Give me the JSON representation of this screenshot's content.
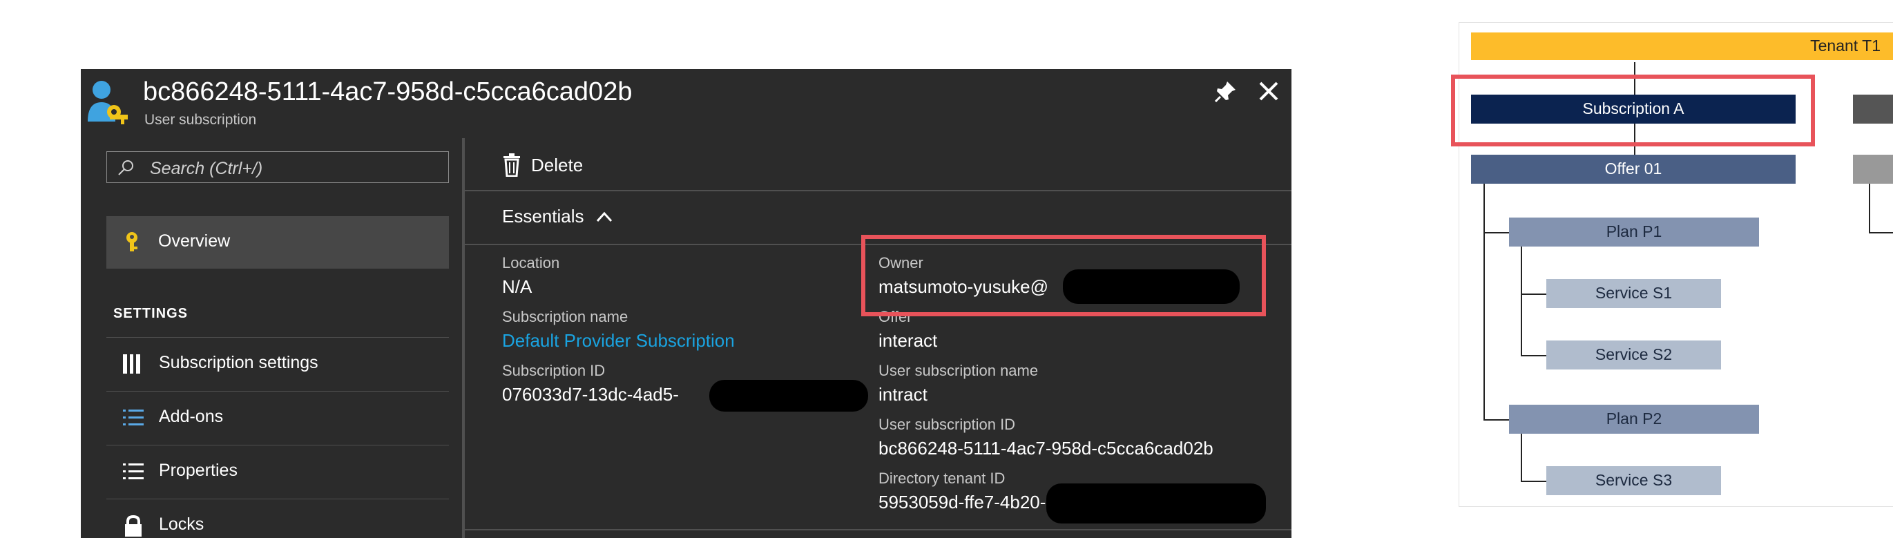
{
  "blade": {
    "title": "bc866248-5111-4ac7-958d-c5cca6cad02b",
    "subtitle": "User subscription",
    "search_placeholder": "Search (Ctrl+/)",
    "nav": {
      "overview": "Overview",
      "settings_header": "SETTINGS",
      "items": [
        "Subscription settings",
        "Add-ons",
        "Properties",
        "Locks"
      ]
    },
    "command_bar": {
      "delete_label": "Delete"
    },
    "essentials_label": "Essentials",
    "fields": {
      "location_label": "Location",
      "location_value": "N/A",
      "subscription_name_label": "Subscription name",
      "subscription_name_value": "Default Provider Subscription",
      "subscription_id_label": "Subscription ID",
      "subscription_id_value": "076033d7-13dc-4ad5-",
      "owner_label": "Owner",
      "owner_value": "matsumoto-yusuke@",
      "offer_label": "Offer",
      "offer_value": "interact",
      "user_sub_name_label": "User subscription name",
      "user_sub_name_value": "intract",
      "user_sub_id_label": "User subscription ID",
      "user_sub_id_value": "bc866248-5111-4ac7-958d-c5cca6cad02b",
      "tenant_id_label": "Directory tenant ID",
      "tenant_id_value": "5953059d-ffe7-4b20-"
    },
    "icons": [
      "subscription-user-key-icon",
      "pin-icon",
      "close-icon",
      "search-icon",
      "key-icon",
      "settings-bars-icon",
      "list-icon",
      "properties-icon",
      "lock-icon",
      "trash-icon",
      "chevron-up-icon"
    ],
    "colors": {
      "background": "#2b2b2b",
      "link": "#1aa3e0",
      "highlight": "#e8535a"
    }
  },
  "diagram": {
    "tenant": "Tenant T1",
    "subscription": "Subscription A",
    "offer": "Offer 01",
    "plans": [
      {
        "name": "Plan P1",
        "services": [
          "Service S1",
          "Service S2"
        ]
      },
      {
        "name": "Plan P2",
        "services": [
          "Service S3"
        ]
      }
    ],
    "colors": {
      "tenant": "#fdbc2a",
      "subscription": "#0b2350",
      "offer": "#4a5f85",
      "plan": "#8393b0",
      "service": "#b0bccd",
      "highlight": "#e8535a"
    }
  }
}
